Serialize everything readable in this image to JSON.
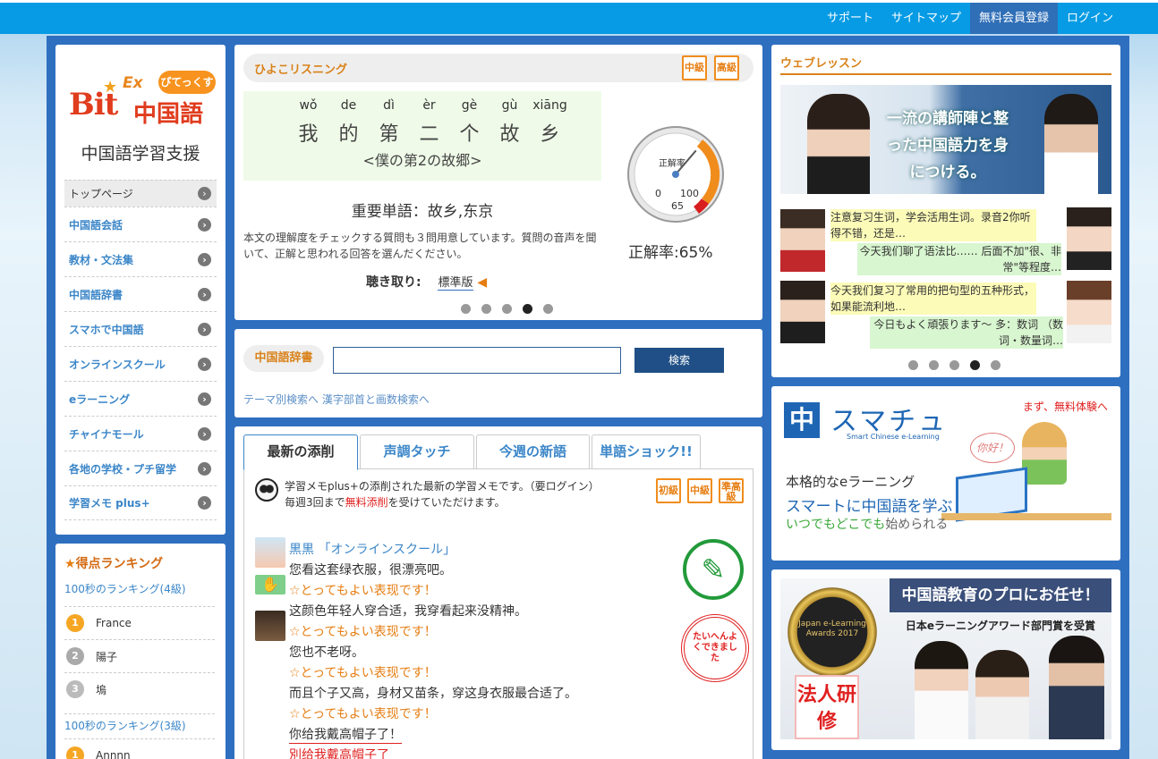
{
  "header": {
    "nav": [
      "サポート",
      "サイトマップ",
      "無料会員登録",
      "ログイン"
    ]
  },
  "logo": {
    "ex": "Ex",
    "bit": "Bit",
    "hiragana": "ぴてっくす",
    "chinese": "中国語"
  },
  "sidebar": {
    "subtitle": "中国語学習支援",
    "items": [
      {
        "label": "トップページ"
      },
      {
        "label": "中国語会話"
      },
      {
        "label": "教材・文法集"
      },
      {
        "label": "中国語辞書"
      },
      {
        "label": "スマホで中国語"
      },
      {
        "label": "オンラインスクール"
      },
      {
        "label": "eラーニング"
      },
      {
        "label": "チャイナモール"
      },
      {
        "label": "各地の学校・プチ留学"
      },
      {
        "label": "学習メモ plus+"
      }
    ]
  },
  "ranking": {
    "title": "得点ランキング",
    "level4": "100秒のランキング(4級)",
    "entries4": [
      {
        "rank": "1",
        "name": "France"
      },
      {
        "rank": "2",
        "name": "陽子"
      },
      {
        "rank": "3",
        "name": "塢"
      }
    ],
    "level3": "100秒のランキング(3級)",
    "entries3": [
      {
        "rank": "1",
        "name": "Annnn"
      }
    ]
  },
  "listening": {
    "title": "ひよこリスニング",
    "levels": [
      "中級",
      "高級"
    ],
    "pinyin": [
      "wǒ",
      "de",
      "dì",
      "èr",
      "gè",
      "gù",
      "xiāng"
    ],
    "hanzi": [
      "我",
      "的",
      "第",
      "二",
      "个",
      "故",
      "乡"
    ],
    "translation": "<僕の第2の故郷>",
    "vocab": "重要単語：故乡,东京",
    "description": "本文の理解度をチェックする質問も３問用意しています。質問の音声を聞いて、正解と思われる回答を選んだください。",
    "listen_label": "聴き取り:",
    "listen_link": "標準版",
    "gauge": {
      "label": "正解率",
      "min": "0",
      "max": "100",
      "value": 65,
      "value_text": "65",
      "result": "正解率:65%"
    },
    "carousel": {
      "count": 5,
      "active": 4
    }
  },
  "dictionary": {
    "label": "中国語辞書",
    "input_value": "",
    "button": "検索",
    "links": "テーマ別検索へ 漢字部首と画数検索へ"
  },
  "tabs": [
    "最新の添削",
    "声調タッチ",
    "今週の新語",
    "単語ショック!!"
  ],
  "memo": {
    "note1": "学習メモplus+の添削された最新の学習メモです。（要ログイン）",
    "note2_pre": "毎週3回まで",
    "note2_red": "無料添削",
    "note2_post": "を受けていただけます。",
    "levels": [
      "初級",
      "中級",
      "準高級"
    ],
    "stamp": "たいへんよくできました",
    "lines": [
      {
        "type": "name",
        "text": "黒黒 「オンラインスクール」"
      },
      {
        "type": "text",
        "text": "您看这套绿衣服，很漂亮吧。"
      },
      {
        "type": "praise",
        "text": "☆とってもよい表现です！"
      },
      {
        "type": "text",
        "text": "这颜色年轻人穿合适，我穿看起来没精神。"
      },
      {
        "type": "praise",
        "text": "☆とってもよい表现です！"
      },
      {
        "type": "text",
        "text": "您也不老呀。"
      },
      {
        "type": "praise",
        "text": "☆とってもよい表现です！"
      },
      {
        "type": "text",
        "text": "而且个子又高，身材又苗条，穿这身衣服最合适了。"
      },
      {
        "type": "praise",
        "text": "☆とってもよい表现です！"
      },
      {
        "type": "text",
        "text": "你给我戴高帽子了！"
      },
      {
        "type": "err",
        "text": "別给我戴高帽子了"
      }
    ]
  },
  "web_lesson": {
    "title": "ウェブレッスン",
    "banner": "一流の講師陣と整った中国語力を身につける。",
    "chats": [
      "注意复习生词，学会活用生词。录音2你听得不错，还是…",
      "今天我们聊了语法比…… 后面不加\"很、非常\"等程度…",
      "今天我们复习了常用的把句型的五种形式，如果能流利地…",
      "今日もよく頑張ります～ 多：数词 （数词・数量词…"
    ],
    "carousel": {
      "count": 5,
      "active": 4
    }
  },
  "sumachu": {
    "logo": "中",
    "name": "スマチュ",
    "tagline": "Smart Chinese e-Learning",
    "promo": "まず、無料体験へ",
    "line1": "本格的なeラーニング",
    "line2": "スマートに中国語を学ぶ",
    "line3a": "いつでもどこでも",
    "line3b": "始められる",
    "bubble": "你好！"
  },
  "award": {
    "heading": "中国語教育のプロにお任せ！",
    "sub": "日本eラーニングアワード部門賞を受賞",
    "badge": "Japan e-Learning Awards 2017",
    "corp": "法人研修"
  }
}
